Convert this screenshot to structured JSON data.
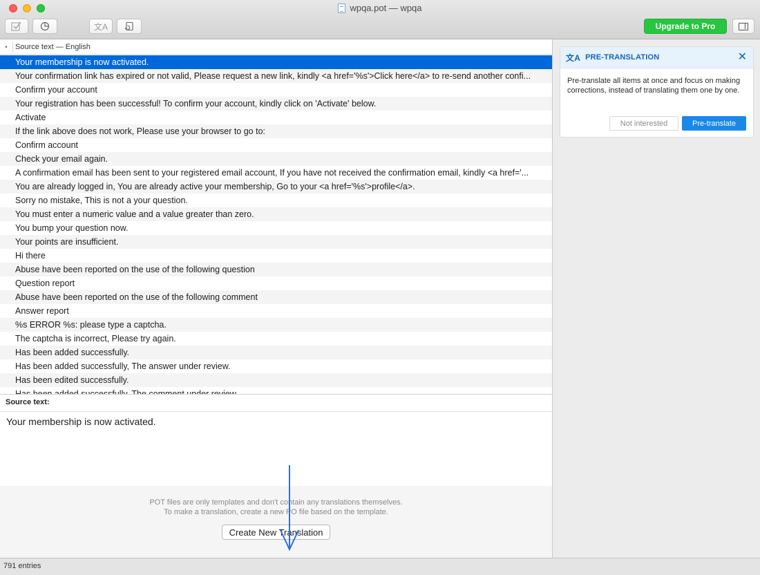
{
  "window": {
    "title": "wpqa.pot — wpqa"
  },
  "toolbar": {
    "validate_icon": "checkbox-icon",
    "stats_icon": "pie-chart-icon",
    "pretranslate_icon": "translate-icon",
    "update_icon": "refresh-doc-icon",
    "upgrade_label": "Upgrade to Pro",
    "sidebar_icon": "sidebar-icon",
    "upgrade_color": "#26c640"
  },
  "list": {
    "column_header": "Source text — English",
    "selected_index": 0,
    "selection_color": "#0068da",
    "rows": [
      "Your membership is now activated.",
      "Your confirmation link has expired or not valid, Please request a new link, kindly <a href='%s'>Click here</a> to re-send another confi...",
      "Confirm your account",
      "Your registration has been successful! To confirm your account, kindly click on 'Activate' below.",
      "Activate",
      "If the link above does not work, Please use your browser to go to:",
      "Confirm account",
      "Check your email again.",
      "A confirmation email has been sent to your registered email account, If you have not received the confirmation email, kindly <a href='...",
      "You are already logged in, You are already active your membership, Go to your <a href='%s'>profile</a>.",
      "Sorry no mistake, This is not a your question.",
      "You must enter a numeric value and a value greater than zero.",
      "You bump your question now.",
      "Your points are insufficient.",
      "Hi there",
      "Abuse have been reported on the use of the following question",
      "Question report",
      "Abuse have been reported on the use of the following comment",
      "Answer report",
      "%s ERROR %s: please type a captcha.",
      "The captcha is incorrect, Please try again.",
      "Has been added successfully.",
      "Has been added successfully, The answer under review.",
      "Has been edited successfully.",
      "Has been added successfully, The comment under review."
    ]
  },
  "editor": {
    "source_label": "Source text:",
    "source_value": "Your membership is now activated."
  },
  "notice": {
    "line1": "POT files are only templates and don't contain any translations themselves.",
    "line2": "To make a translation, create a new PO file based on the template.",
    "create_button": "Create New Translation"
  },
  "pretranslation": {
    "title": "PRE-TRANSLATION",
    "body": "Pre-translate all items at once and focus on making corrections, instead of translating them one by one.",
    "not_interested": "Not interested",
    "pretranslate": "Pre-translate",
    "accent_color": "#1a88e8"
  },
  "status": {
    "entries": "791 entries"
  }
}
